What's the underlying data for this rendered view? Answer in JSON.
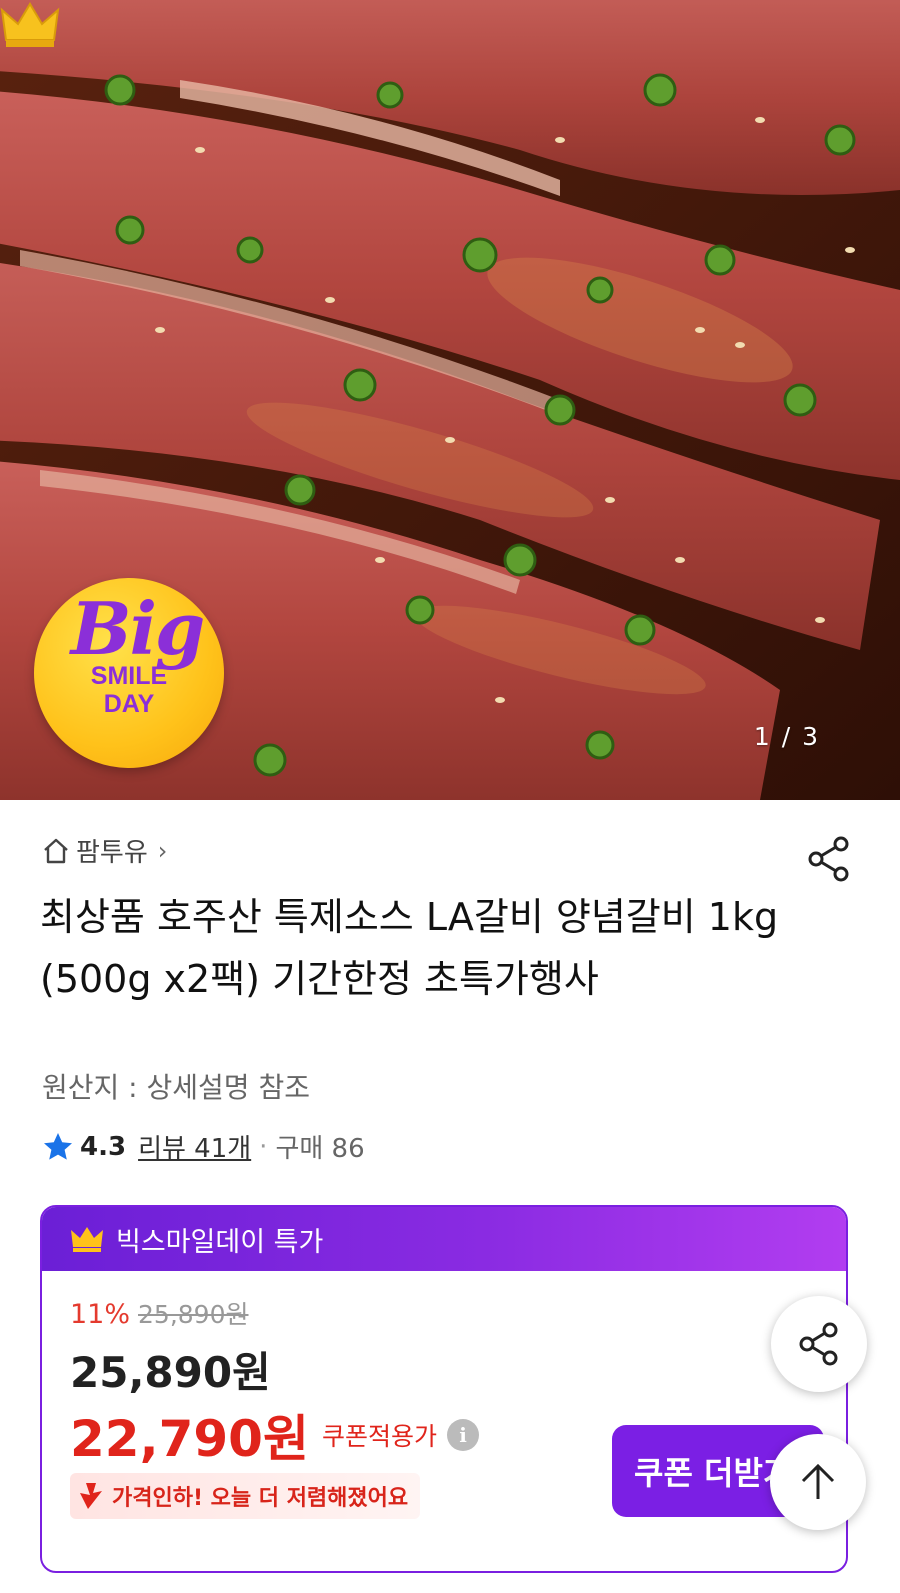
{
  "hero": {
    "image_counter": "1 / 3",
    "badge": {
      "big": "Big",
      "smile": "SMILE",
      "day": "DAY"
    }
  },
  "store": {
    "name": "팜투유",
    "home_icon": "home-icon",
    "chevron": "›"
  },
  "product": {
    "title": "최상품 호주산 특제소스 LA갈비 양념갈비 1kg (500g x2팩) 기간한정 초특가행사",
    "origin": "원산지 : 상세설명 참조",
    "rating": "4.3",
    "reviews": "리뷰 41개",
    "purchases": "구매 86"
  },
  "deal": {
    "header": "빅스마일데이 특가",
    "discount": "11%",
    "original_price": "25,890원",
    "price": "25,890원",
    "coupon_price": "22,790원",
    "coupon_label": "쿠폰적용가",
    "price_drop_text": "가격인하! 오늘 더 저렴해졌어요",
    "coupon_button": "쿠폰 더받기"
  },
  "colors": {
    "accent_purple": "#7b1fe4",
    "price_red": "#e0241b",
    "star_blue": "#1a73e8",
    "badge_yellow": "#ffc21a"
  }
}
